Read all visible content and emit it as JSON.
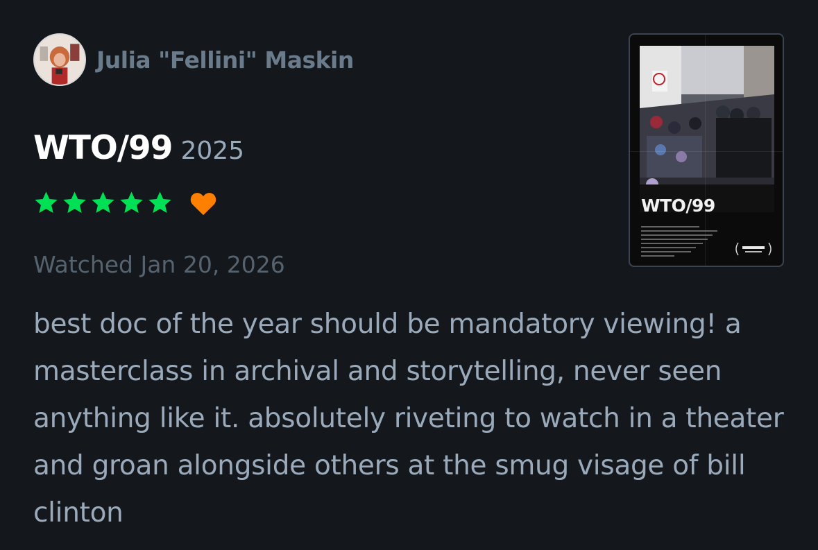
{
  "author": {
    "name": "Julia \"Fellini\" Maskin",
    "avatar_icon": "user-avatar"
  },
  "film": {
    "title": "WTO/99",
    "year": "2025",
    "poster_title": "WTO/99"
  },
  "rating": {
    "stars": 5,
    "max_stars": 5,
    "liked": true,
    "star_color": "#00e054",
    "heart_color": "#ff8000"
  },
  "watched": {
    "text": "Watched Jan 20, 2026"
  },
  "review": {
    "text": "best doc of the year should be mandatory viewing! a masterclass in archival and storytelling, never seen anything like it. absolutely riveting to watch in a theater and groan alongside others at the smug visage of bill clinton"
  },
  "colors": {
    "background": "#14181c",
    "title": "#ffffff",
    "muted": "#99aabb"
  }
}
